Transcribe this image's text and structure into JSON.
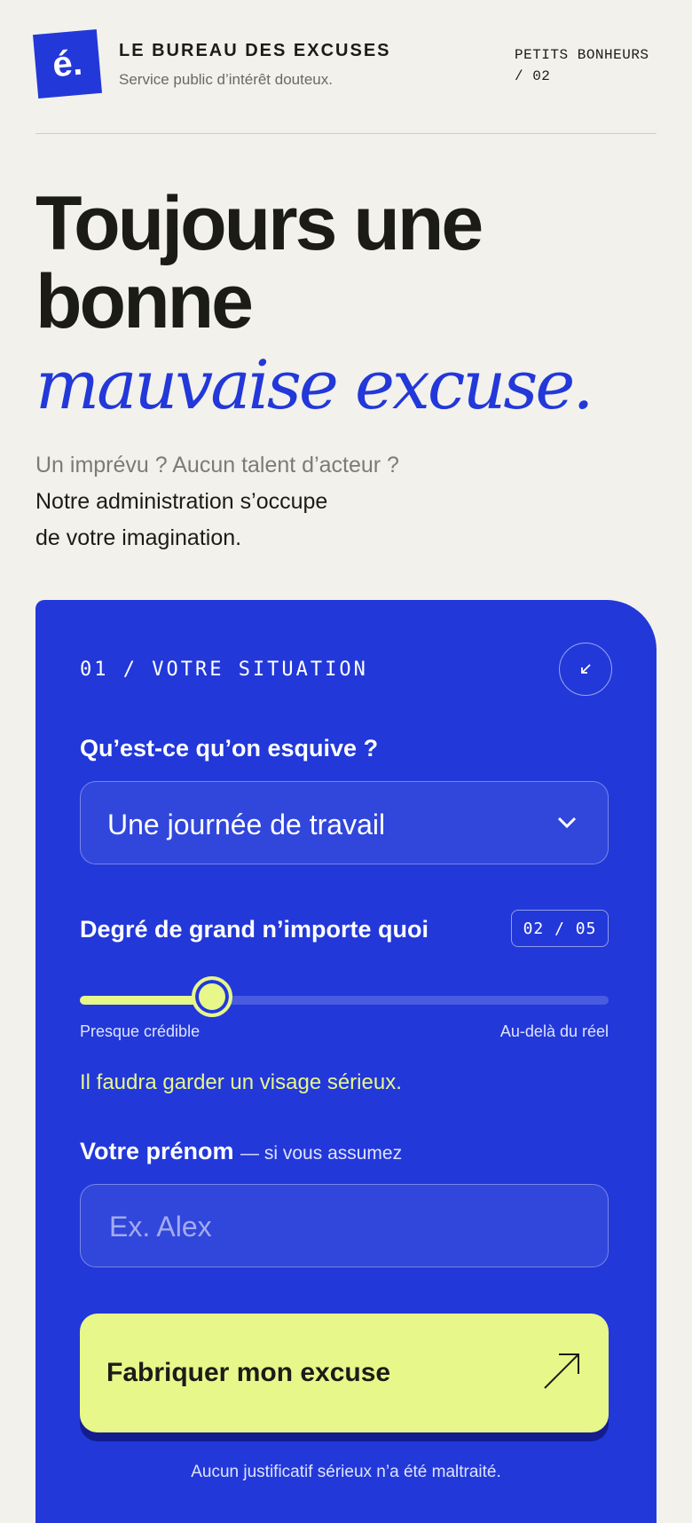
{
  "brand": {
    "logo_text": "é.",
    "title": "LE BUREAU DES EXCUSES",
    "subtitle": "Service public d’intérêt douteux.",
    "issue_line1": "PETITS BONHEURS",
    "issue_line2": "/ 02"
  },
  "hero": {
    "line1": "Toujours une",
    "line2": "bonne",
    "accent": "mauvaise excuse."
  },
  "intro": {
    "muted": "Un imprévu ? Aucun talent d’acteur ?",
    "line2": "Notre administration s’occupe",
    "line3": "de votre imagination."
  },
  "form": {
    "step": "01 / VOTRE SITUATION",
    "corner_icon": "arrow-down-left-icon",
    "situation_label": "Qu’est-ce qu’on esquive ?",
    "situation_value": "Une journée de travail",
    "degree_label": "Degré de grand n’importe quoi",
    "degree_counter": "02 / 05",
    "degree_value": 2,
    "degree_max": 5,
    "range_min_label": "Presque crédible",
    "range_max_label": "Au-delà du réel",
    "tone_text": "Il faudra garder un visage sérieux.",
    "name_label": "Votre prénom",
    "name_hint": "— si vous assumez",
    "name_placeholder": "Ex. Alex",
    "name_value": "",
    "submit_label": "Fabriquer mon excuse",
    "submit_icon": "arrow-up-right-icon",
    "disclaimer": "Aucun justificatif sérieux n’a été maltraité."
  },
  "colors": {
    "background": "#f3f1ec",
    "accent_blue": "#2238d9",
    "highlight": "#e7f78a",
    "ink": "#1c1c17"
  }
}
